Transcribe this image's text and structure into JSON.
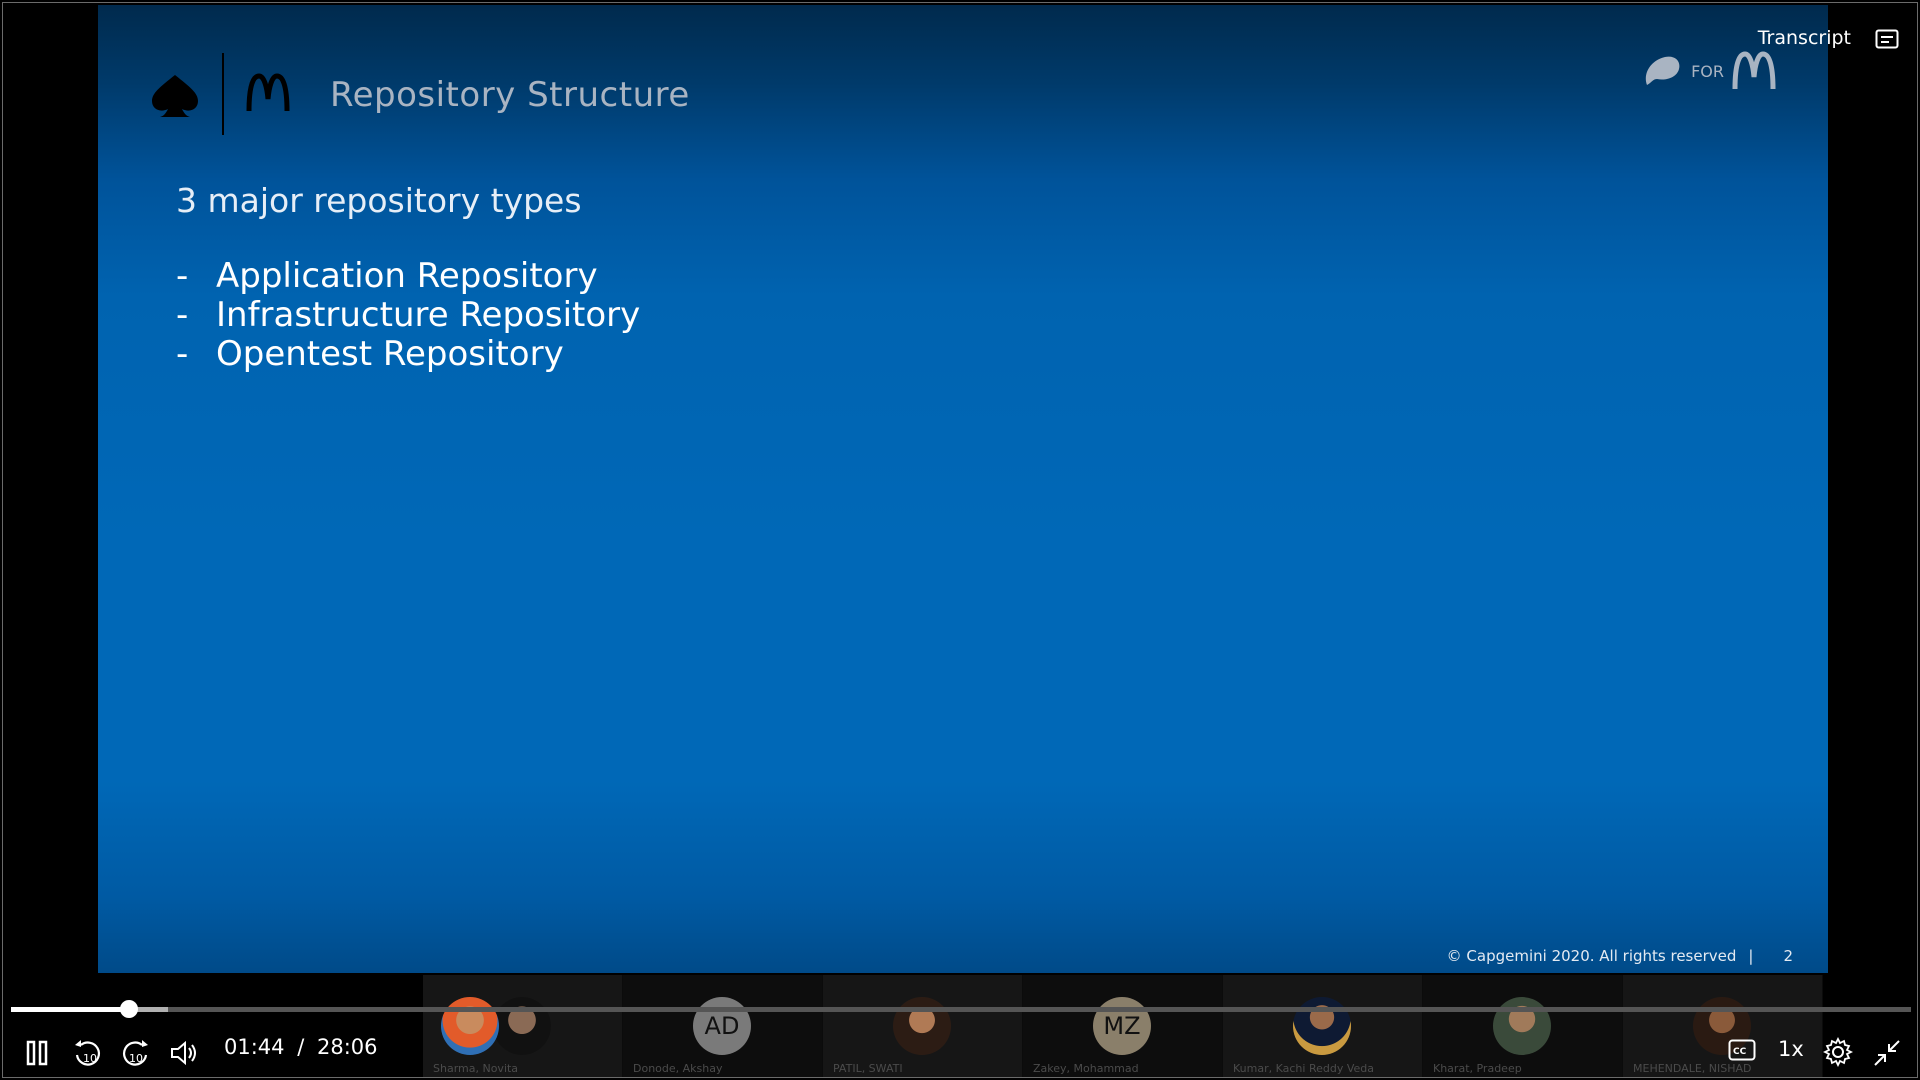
{
  "slide": {
    "title": "Repository Structure",
    "logo_right_text": "FOR",
    "subtitle": "3 major repository types",
    "bullets": [
      {
        "dash": "-",
        "text": "Application Repository"
      },
      {
        "dash": "-",
        "text": "Infrastructure Repository"
      },
      {
        "dash": "-",
        "text": "Opentest Repository"
      }
    ],
    "footer_copyright": "© Capgemini 2020. All rights reserved",
    "footer_sep": "|",
    "page_number": "2"
  },
  "header": {
    "transcript_label": "Transcript"
  },
  "player": {
    "current_time": "01:44",
    "time_sep": "/",
    "duration": "28:06",
    "progress_fraction": 0.062,
    "speed_label": "1x"
  },
  "participants": [
    {
      "name": "Sharma, Novita",
      "initials": ""
    },
    {
      "name": "Donode, Akshay",
      "initials": "AD"
    },
    {
      "name": "PATIL, SWATI",
      "initials": ""
    },
    {
      "name": "Zakey, Mohammad",
      "initials": "MZ"
    },
    {
      "name": "Kumar, Kachi Reddy Veda",
      "initials": ""
    },
    {
      "name": "Kharat, Pradeep",
      "initials": ""
    },
    {
      "name": "MEHENDALE, NISHAD",
      "initials": ""
    }
  ],
  "icons": [
    "spade-logo-icon",
    "mcdonalds-logo-icon",
    "transcript-icon",
    "pause-icon",
    "rewind-10-icon",
    "forward-10-icon",
    "volume-icon",
    "captions-icon",
    "settings-icon",
    "exit-fullscreen-icon"
  ]
}
